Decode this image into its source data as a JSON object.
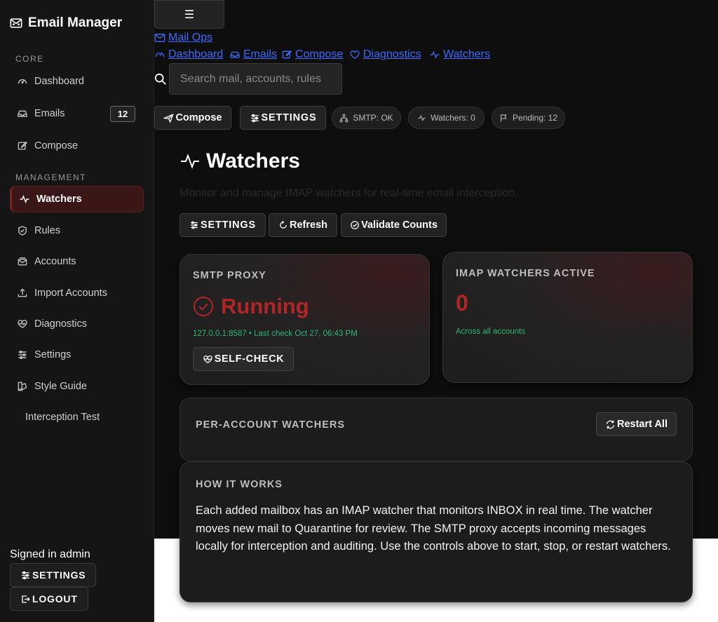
{
  "app": {
    "title": "Email Manager"
  },
  "sidebar": {
    "sections": {
      "core": "CORE",
      "management": "MANAGEMENT"
    },
    "items": [
      {
        "label": "Dashboard",
        "icon": "gauge-icon"
      },
      {
        "label": "Emails",
        "icon": "inbox-icon",
        "badge": "12"
      },
      {
        "label": "Compose",
        "icon": "compose-icon"
      },
      {
        "label": "Watchers",
        "icon": "activity-icon",
        "active": true
      },
      {
        "label": "Rules",
        "icon": "shield-icon"
      },
      {
        "label": "Accounts",
        "icon": "mail-stack-icon"
      },
      {
        "label": "Import Accounts",
        "icon": "upload-icon"
      },
      {
        "label": "Diagnostics",
        "icon": "heart-pulse-icon"
      },
      {
        "label": "Settings",
        "icon": "sliders-icon"
      },
      {
        "label": "Style Guide",
        "icon": "palette-icon"
      },
      {
        "label": "Interception Test"
      }
    ],
    "signed_in": "Signed in admin",
    "settings_label": "SETTINGS",
    "logout_label": "LOGOUT"
  },
  "header": {
    "menu_glyph": "☰",
    "brand_link": "Mail Ops",
    "nav_links": [
      "Dashboard",
      "Emails",
      "Compose",
      "Diagnostics",
      "Watchers"
    ],
    "search_placeholder": "Search mail, accounts, rules"
  },
  "toolbar": {
    "compose_label": "Compose",
    "settings_label": "SETTINGS",
    "pills": [
      "SMTP: OK",
      "Watchers: 0",
      "Pending: 12"
    ]
  },
  "page": {
    "title": "Watchers",
    "subtitle": "Monitor and manage IMAP watchers for real-time email interception.",
    "actions": [
      "SETTINGS",
      "Refresh",
      "Validate Counts"
    ]
  },
  "smtp_card": {
    "label": "SMTP PROXY",
    "status": "Running",
    "detail": "127.0.0.1:8587 • Last check Oct 27, 06:43 PM",
    "button": "SELF-CHECK"
  },
  "imap_card": {
    "label": "IMAP WATCHERS ACTIVE",
    "count": "0",
    "detail": "Across all accounts"
  },
  "per_account": {
    "label": "PER-ACCOUNT WATCHERS",
    "button": "Restart All"
  },
  "how_it_works": {
    "label": "HOW IT WORKS",
    "text": "Each added mailbox has an IMAP watcher that monitors INBOX in real time. The watcher moves new mail to Quarantine for review. The SMTP proxy accepts incoming messages locally for interception and auditing. Use the controls above to start, stop, or restart watchers."
  },
  "colors": {
    "accent_red": "#b02626",
    "success_green": "#25b872",
    "link_blue": "#3d6bff",
    "sidebar_bg": "#151515",
    "main_bg": "#0e0e0e"
  }
}
